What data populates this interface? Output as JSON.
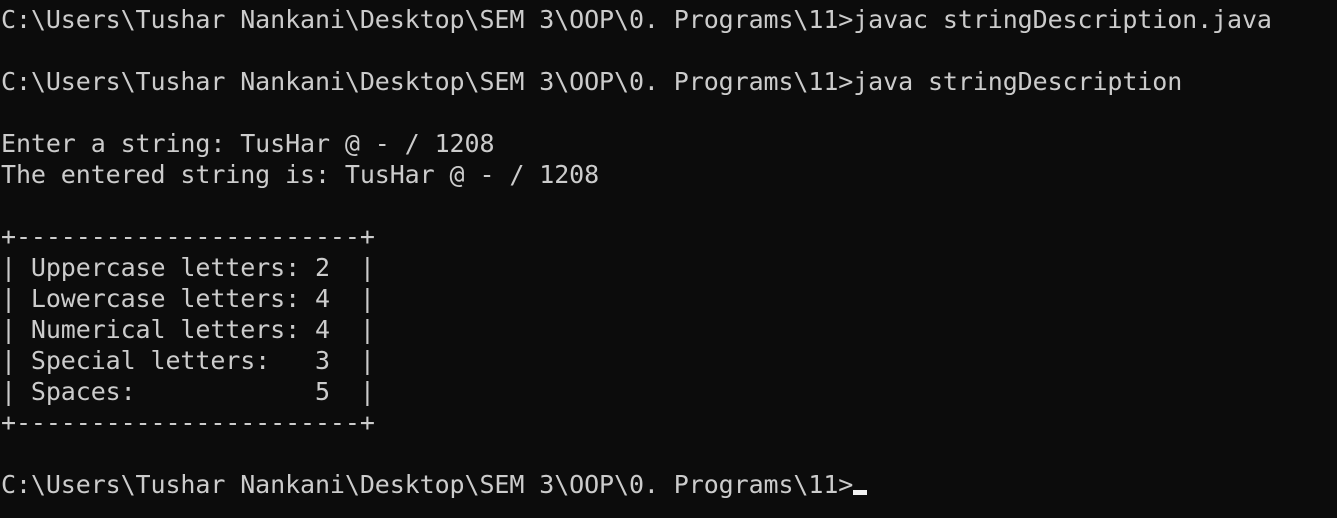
{
  "console": {
    "lines": [
      "C:\\Users\\Tushar Nankani\\Desktop\\SEM 3\\OOP\\0. Programs\\11>javac stringDescription.java",
      "",
      "C:\\Users\\Tushar Nankani\\Desktop\\SEM 3\\OOP\\0. Programs\\11>java stringDescription",
      "",
      "Enter a string: TusHar @ - / 1208",
      "The entered string is: TusHar @ - / 1208",
      "",
      "+-----------------------+",
      "| Uppercase letters: 2  |",
      "| Lowercase letters: 4  |",
      "| Numerical letters: 4  |",
      "| Special letters:   3  |",
      "| Spaces:            5  |",
      "+-----------------------+",
      "",
      "C:\\Users\\Tushar Nankani\\Desktop\\SEM 3\\OOP\\0. Programs\\11>"
    ]
  },
  "colors": {
    "background": "#0c0c0c",
    "foreground": "#cccccc",
    "cursor": "#f2f2f2"
  }
}
